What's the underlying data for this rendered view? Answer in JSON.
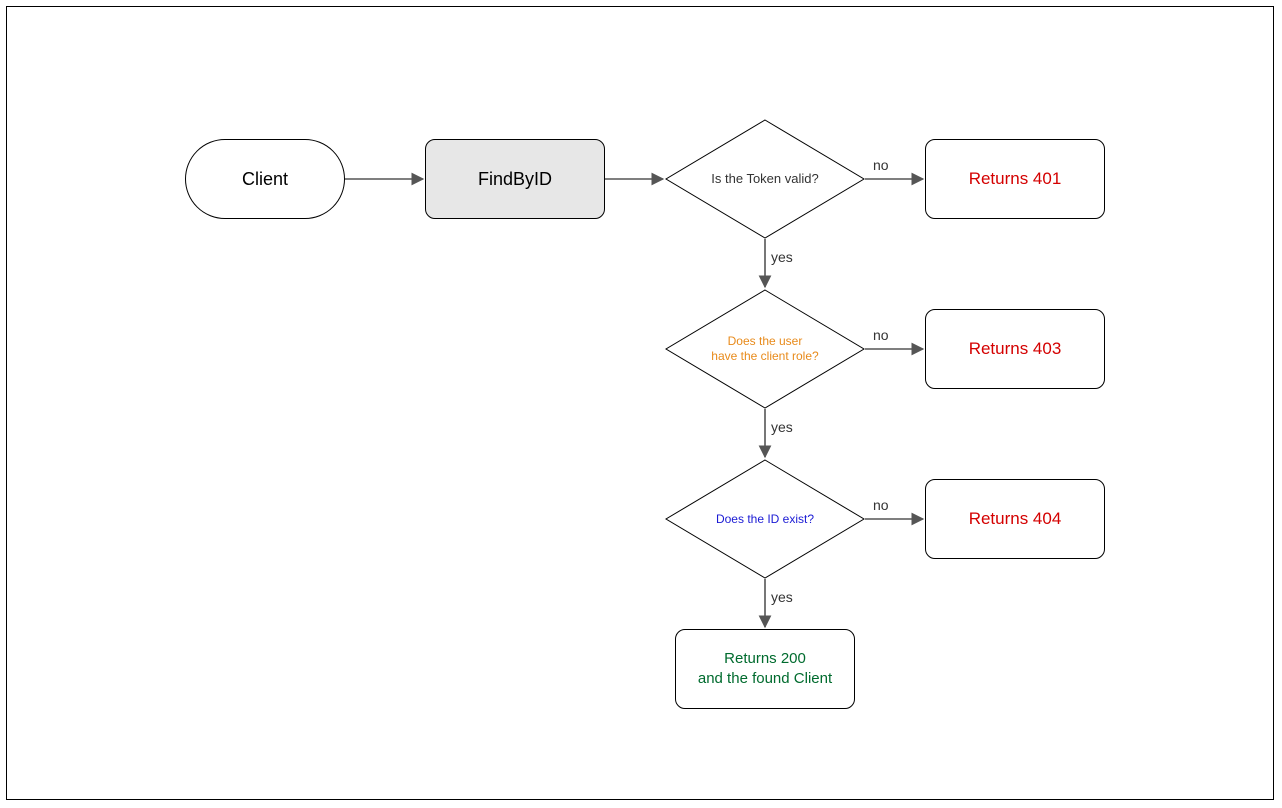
{
  "nodes": {
    "client": {
      "label": "Client"
    },
    "findById": {
      "label": "FindByID"
    },
    "decisionToken": {
      "label": "Is the Token valid?",
      "color": "#333333",
      "fontSize": "13px"
    },
    "decisionRole": {
      "label": "Does the user\nhave the client role?",
      "color": "#e88a1a",
      "fontSize": "12px"
    },
    "decisionId": {
      "label": "Does the ID exist?",
      "color": "#1a1ad4",
      "fontSize": "12px"
    },
    "ret401": {
      "label": "Returns 401"
    },
    "ret403": {
      "label": "Returns 403"
    },
    "ret404": {
      "label": "Returns 404"
    },
    "ret200": {
      "label": "Returns 200\nand the found Client"
    }
  },
  "edgeLabels": {
    "yes": "yes",
    "no": "no"
  },
  "colors": {
    "arrow": "#555555",
    "border": "#000000"
  }
}
